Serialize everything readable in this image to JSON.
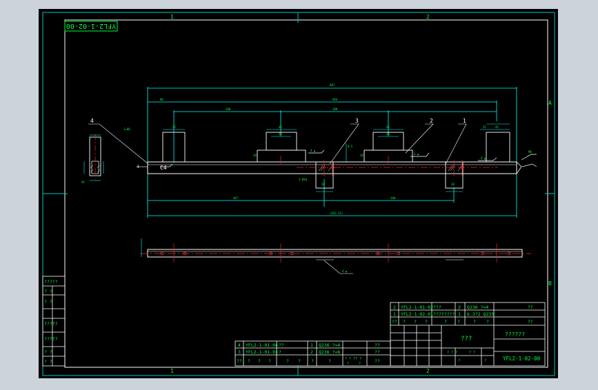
{
  "colors": {
    "background": "#cdd3db",
    "paper": "#000000",
    "frame": "#00c8c8",
    "part": "#ffffff",
    "dimension": "#00ffff",
    "centerline": "#ff2020",
    "text": "#00ff40",
    "hatch": "#ffffff"
  },
  "drawing_number_rotated": "YFL2-1-02-00",
  "zone_labels": {
    "top_1": "1",
    "top_2": "2",
    "bottom_1": "1",
    "bottom_2": "2",
    "right_a": "A",
    "right_b": "B"
  },
  "balloons": [
    "4",
    "3",
    "2",
    "1"
  ],
  "view_annotations": {
    "c_chamfer": "C4",
    "left_mark": "4"
  },
  "left_stamp_rows": [
    "?????",
    "?  ?",
    "?  ?",
    "?????",
    "?????",
    "?  ?",
    "?  ?"
  ],
  "title_block": {
    "bom_top": [
      {
        "no": "2",
        "code": "YFL2-1-01-02",
        "name": "???",
        "qty": "2",
        "material": "Q236  ?=4",
        "note": "??"
      },
      {
        "no": "1",
        "code": "YFL2-1-02-01",
        "name": "????????",
        "qty": "1",
        "material": "6.3?2  Q235",
        "note": ""
      }
    ],
    "header_row": [
      "??",
      "?",
      "?",
      "?",
      "?",
      "?",
      "?",
      "?",
      "??"
    ],
    "center_name": "???",
    "right_name": "??????",
    "scale_cells": [
      "? ? ?",
      "? ?",
      "?",
      "?"
    ],
    "drawing_number": "YFL2-1-02-00"
  },
  "bom_bottom": [
    {
      "no": "4",
      "code": "YFL2-1-01-04",
      "name": "??",
      "qty": "1",
      "material": "Q236 ?=4",
      "note": "??"
    },
    {
      "no": "3",
      "code": "YFL2-1-01-03",
      "name": "?",
      "qty": "2",
      "material": "Q236 ?=6",
      "note": "??"
    }
  ],
  "bom_bottom_header": [
    "??",
    "?",
    "?",
    "?",
    "?",
    "?",
    "?",
    "?",
    "??"
  ],
  "bom_bottom_small": [
    "? ? ?",
    "? ?",
    "?",
    "?"
  ]
}
